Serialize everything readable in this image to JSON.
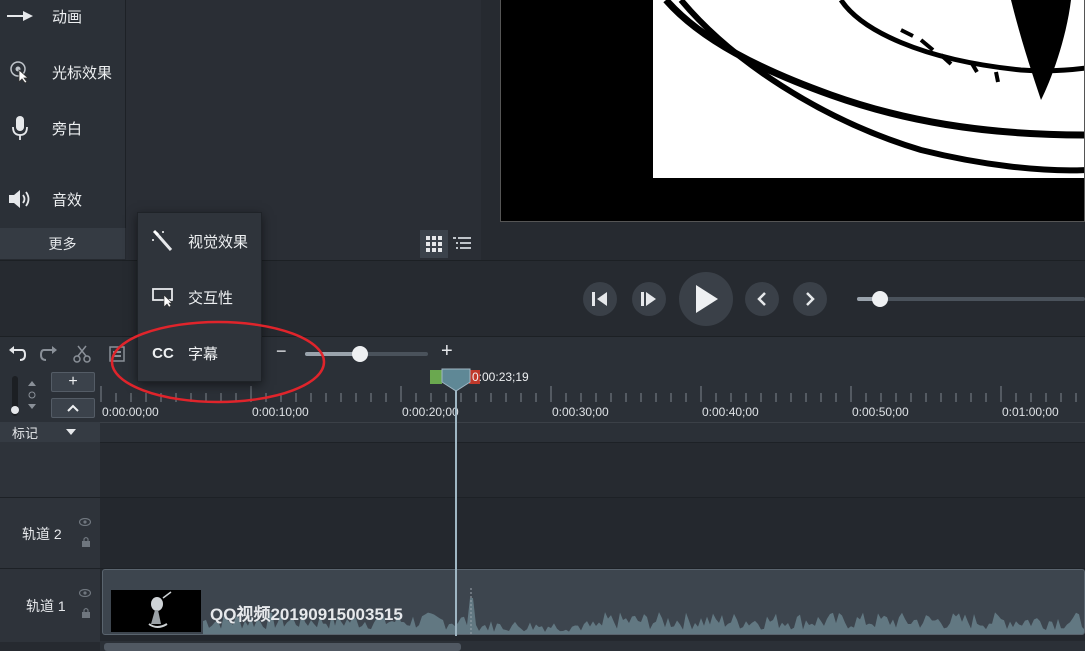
{
  "tools": [
    {
      "label": "动画",
      "icon": "arrow-right-icon"
    },
    {
      "label": "光标效果",
      "icon": "cursor-icon"
    },
    {
      "label": "旁白",
      "icon": "microphone-icon"
    },
    {
      "label": "音效",
      "icon": "speaker-icon"
    }
  ],
  "more_tab": {
    "label": "更多"
  },
  "more_menu": {
    "items": [
      {
        "label": "视觉效果",
        "icon": "magic-wand-icon"
      },
      {
        "label": "交互性",
        "icon": "interactive-icon"
      },
      {
        "label": "字幕",
        "icon": "cc-icon",
        "icon_text": "CC"
      }
    ]
  },
  "timeline": {
    "playhead_time": "0:00:23;19",
    "ticks": [
      "0:00:00;00",
      "0:00:10;00",
      "0:00:20;00",
      "0:00:30;00",
      "0:00:40;00",
      "0:00:50;00",
      "0:01:00;00"
    ],
    "zoom_minus": "−",
    "zoom_plus": "+",
    "zoom_level": 0.45,
    "add_track": "+",
    "marker_label": "标记",
    "tracks": [
      {
        "label": "轨道 2"
      },
      {
        "label": "轨道 1",
        "clip_title": "QQ视频20190915003515"
      }
    ]
  },
  "playback": {
    "volume_level": 0.1
  },
  "colors": {
    "annotation_circle": "#e0242b",
    "playhead": "#5f8896",
    "in_marker": "#6aa84f",
    "out_marker": "#c0392b"
  }
}
